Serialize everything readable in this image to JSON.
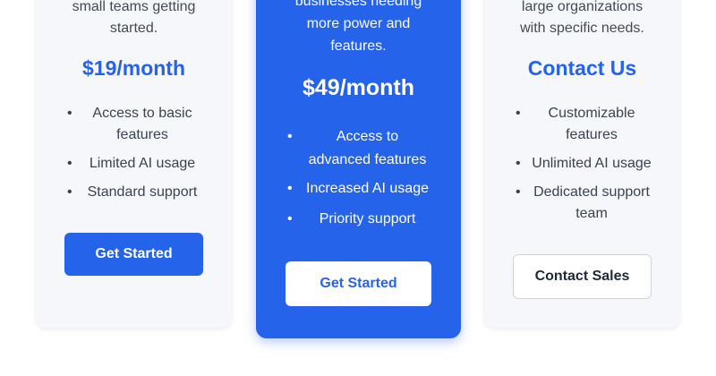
{
  "plans": {
    "basic": {
      "description": [
        "small teams getting",
        "started."
      ],
      "price": "$19/month",
      "features": [
        [
          "Access to basic",
          "features"
        ],
        [
          "Limited AI usage"
        ],
        [
          "Standard support"
        ]
      ],
      "button_label": "Get Started"
    },
    "pro": {
      "description": [
        "businesses needing",
        "more power and",
        "features."
      ],
      "price": "$49/month",
      "features": [
        [
          "Access to",
          "advanced features"
        ],
        [
          "Increased AI usage"
        ],
        [
          "Priority support"
        ]
      ],
      "button_label": "Get Started"
    },
    "enterprise": {
      "description": [
        "large organizations",
        "with specific needs."
      ],
      "price": "Contact Us",
      "features": [
        [
          "Customizable",
          "features"
        ],
        [
          "Unlimited AI usage"
        ],
        [
          "Dedicated support",
          "team"
        ]
      ],
      "button_label": "Contact Sales"
    }
  },
  "colors": {
    "accent": "#2563eb",
    "card_bg": "#f5f7fa",
    "text": "#3b4250"
  },
  "bullet_glyph": "•"
}
